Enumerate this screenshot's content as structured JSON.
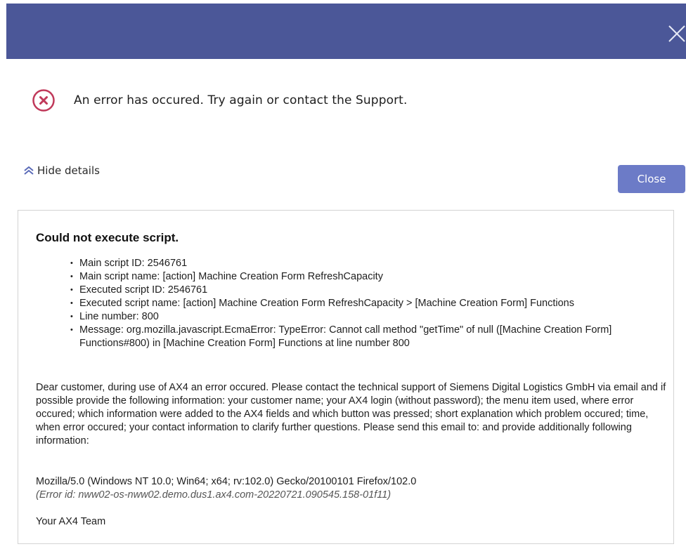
{
  "dialog": {
    "message": "An error has occured. Try again or contact the Support.",
    "hide_details_label": "Hide details",
    "close_label": "Close"
  },
  "details": {
    "title": "Could not execute script.",
    "items": [
      "Main script ID: 2546761",
      "Main script name: [action] Machine Creation Form RefreshCapacity",
      "Executed script ID: 2546761",
      "Executed script name: [action] Machine Creation Form RefreshCapacity > [Machine Creation Form] Functions",
      "Line number: 800",
      "Message: org.mozilla.javascript.EcmaError: TypeError: Cannot call method \"getTime\" of null ([Machine Creation Form] Functions#800) in [Machine Creation Form] Functions at line number 800"
    ],
    "description": "Dear customer, during use of AX4 an error occured. Please contact the technical support of Siemens Digital Logistics GmbH via email and if possible provide the following information: your customer name; your AX4 login (without password); the menu item used, where error occured; which information were added to the AX4 fields and which button was pressed; short explanation which problem occured; time, when error occured; your contact information to clarify further questions. Please send this email to: and provide additionally following information:",
    "user_agent": "Mozilla/5.0 (Windows NT 10.0; Win64; x64; rv:102.0) Gecko/20100101 Firefox/102.0",
    "error_id": "(Error id: nww02-os-nww02.demo.dus1.ax4.com-20220721.090545.158-01f11)",
    "signature": "Your AX4 Team"
  },
  "icons": {
    "title_close": "close-icon",
    "error": "error-circle-icon",
    "collapse": "double-chevron-up-icon"
  },
  "colors": {
    "titlebar": "#4b5798",
    "close_button": "#6c7bc7",
    "error_icon": "#c0395a"
  }
}
